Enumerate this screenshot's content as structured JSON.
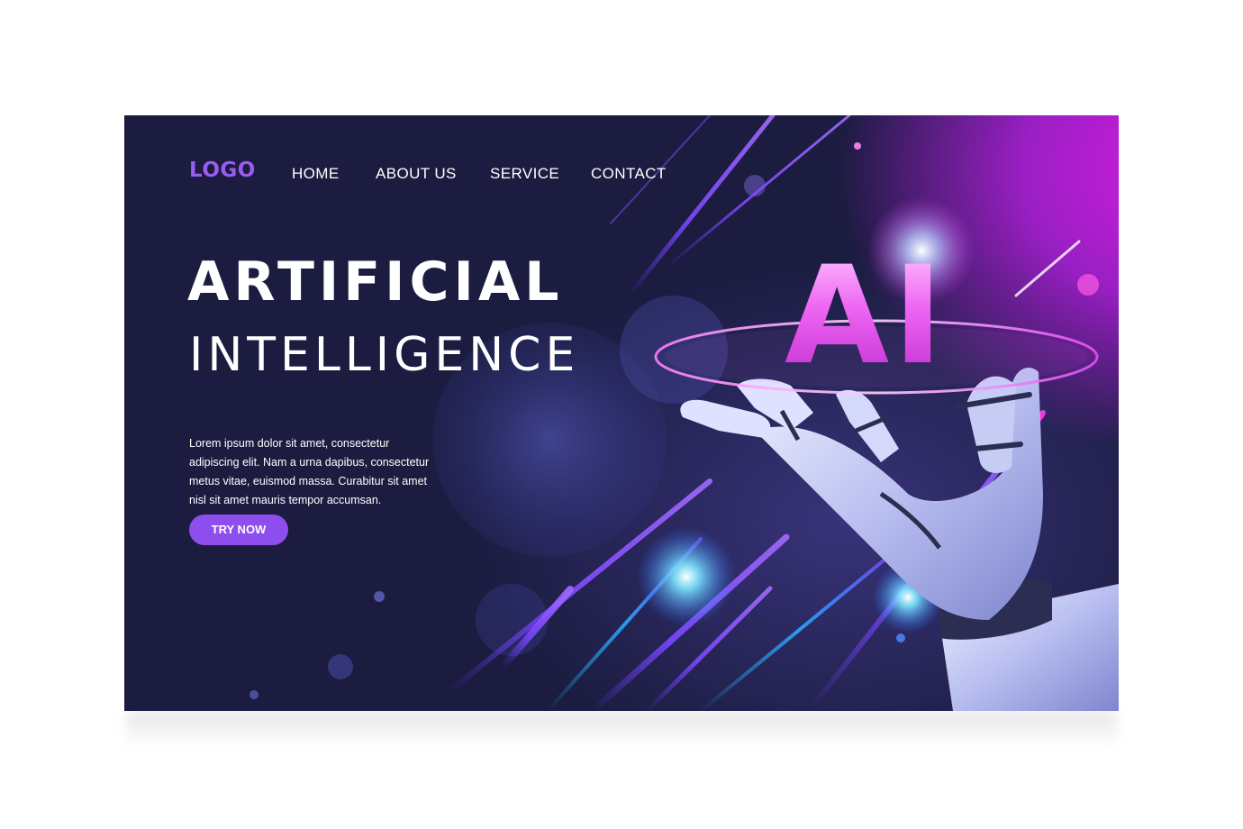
{
  "brand": {
    "logo": "LOGO"
  },
  "nav": {
    "items": [
      {
        "label": "HOME"
      },
      {
        "label": "ABOUT US"
      },
      {
        "label": "SERVICE"
      },
      {
        "label": "CONTACT"
      }
    ]
  },
  "hero": {
    "title_line1": "ARTIFICIAL",
    "title_line2": "INTELLIGENCE",
    "description": "Lorem ipsum dolor sit amet, consectetur adipiscing elit. Nam a urna dapibus, consectetur metus vitae, euismod massa. Curabitur sit amet nisl sit amet mauris tempor accumsan.",
    "cta_label": "TRY NOW",
    "graphic_text": "AI"
  },
  "colors": {
    "background": "#1b1c40",
    "accent": "#8e4ded",
    "logo": "#9a5cf0",
    "glow": "#d61ce0"
  },
  "icons": {
    "hero_graphic": "robot-hand-icon"
  }
}
